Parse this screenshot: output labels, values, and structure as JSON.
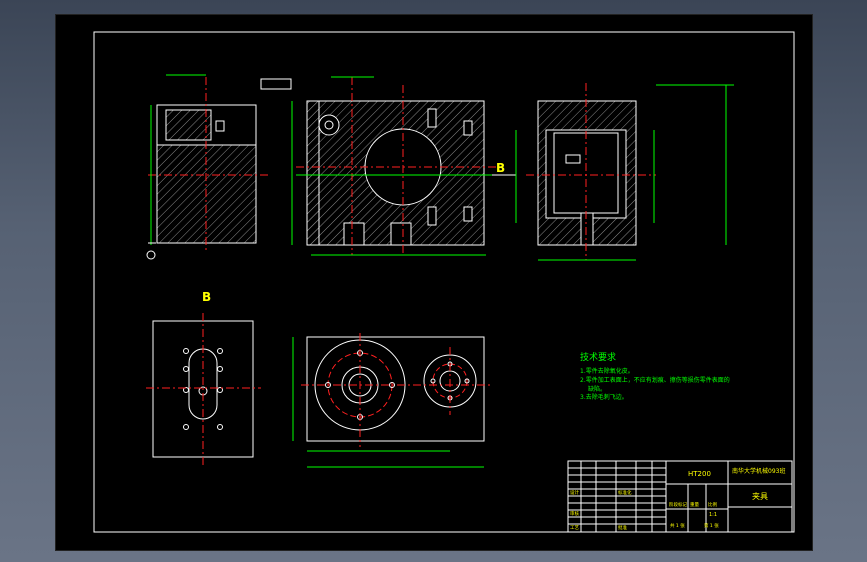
{
  "colors": {
    "background": "#000000",
    "outline": "#ffffff",
    "hatch": "#9a9a9a",
    "centerline": "#ff2020",
    "dimension": "#00ff00",
    "text": "#ffff00"
  },
  "views": {
    "section_label_B": "B",
    "view_label_B": "B"
  },
  "tech_requirements": {
    "title": "技术要求",
    "items": [
      "1.零件去除氧化皮。",
      "2.零件加工表面上，不应有划痕、擦伤等损伤零件表面的",
      "缺陷。",
      "3.去除毛刺飞边。"
    ]
  },
  "title_block": {
    "material": "HT200",
    "school": "南华大学机械093班",
    "part_name": "夹具",
    "scale": "1:1",
    "labels": [
      "设计",
      "审核",
      "工艺",
      "批准",
      "标准化",
      "重量",
      "比例",
      "共 1 张",
      "第 1 张",
      "阶段标记"
    ]
  }
}
